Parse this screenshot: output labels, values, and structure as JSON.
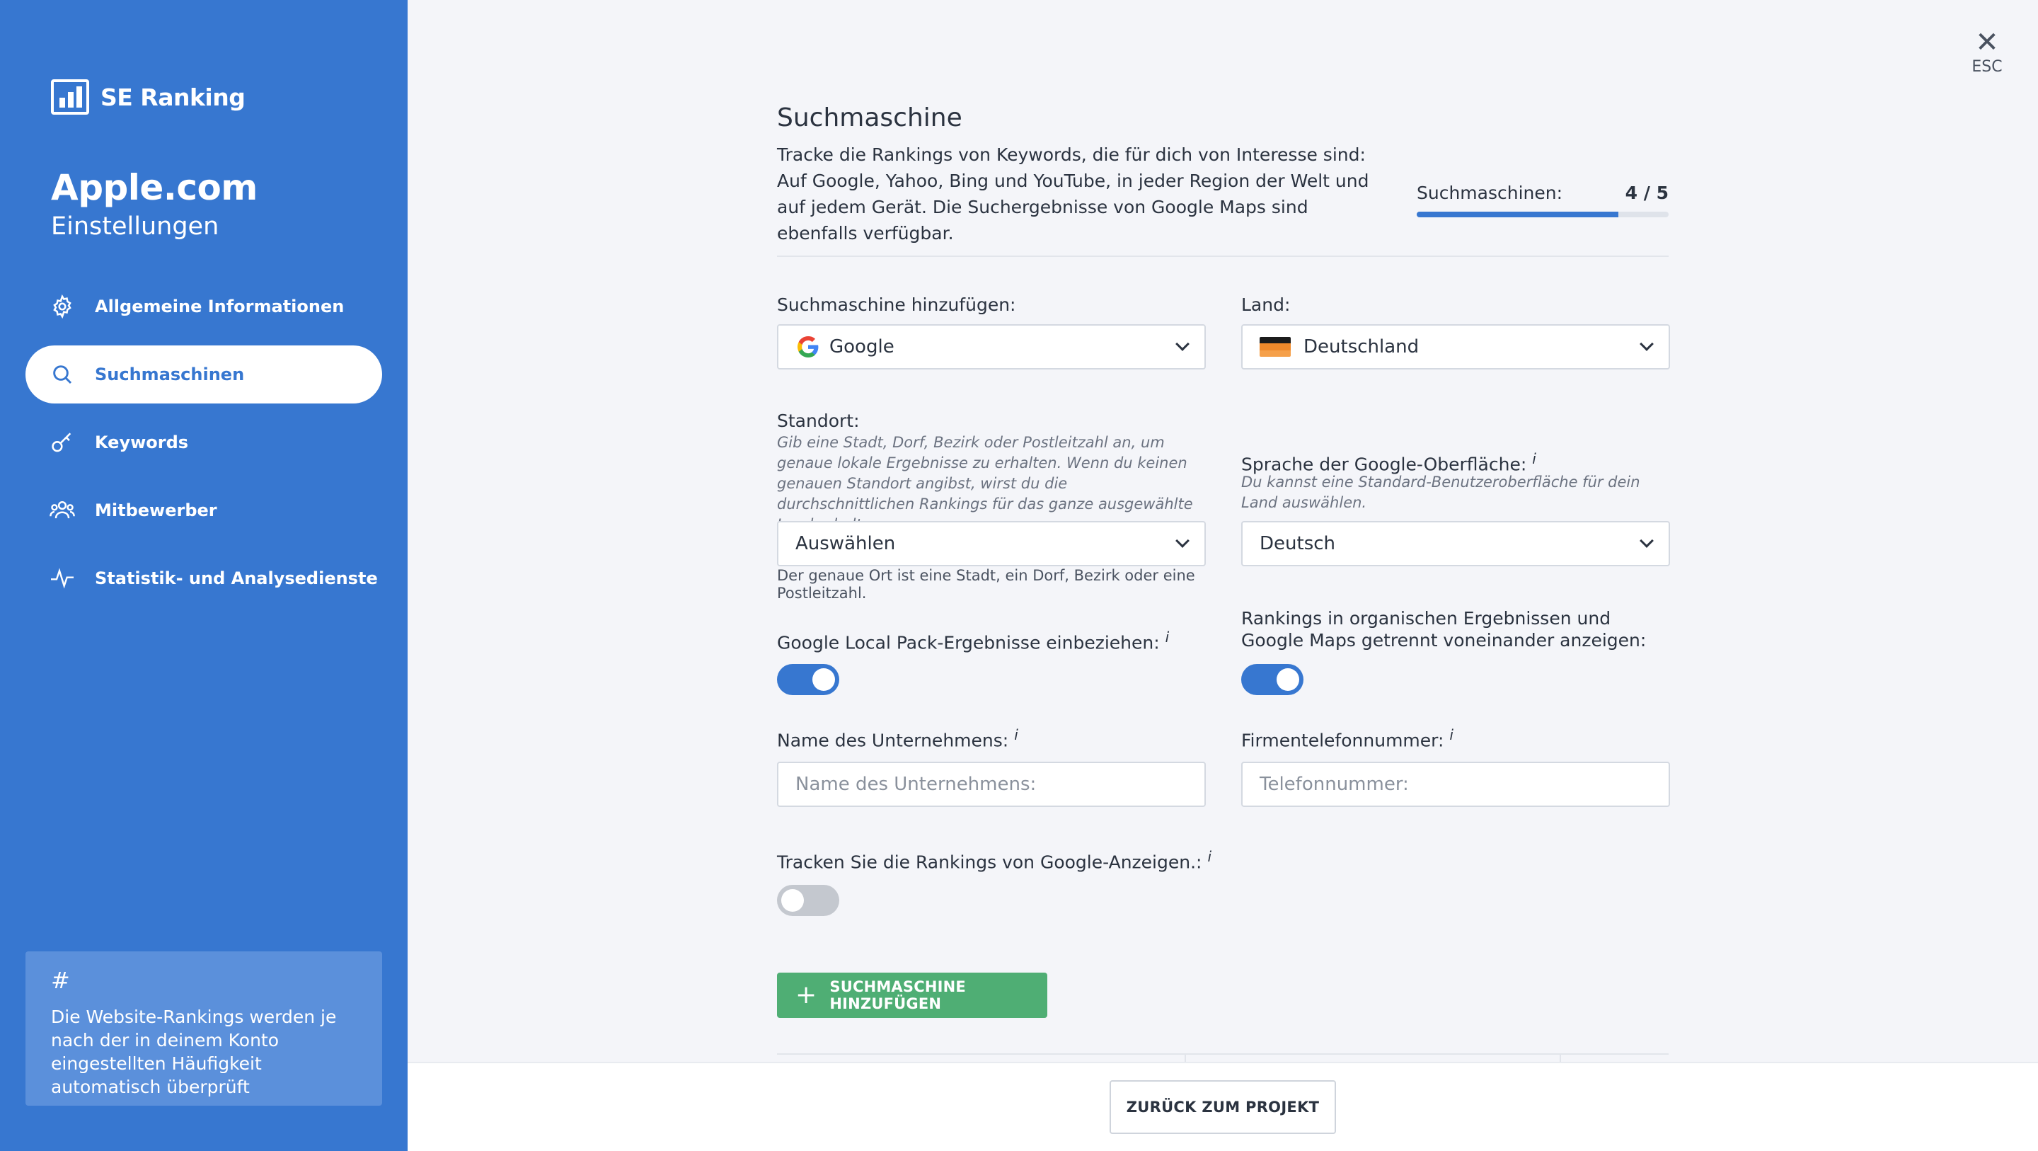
{
  "app": {
    "logo_text": "SE Ranking",
    "project_title": "Apple.com",
    "project_subtitle": "Einstellungen"
  },
  "sidebar": {
    "items": [
      {
        "label": "Allgemeine Informationen",
        "icon": "gear-icon"
      },
      {
        "label": "Suchmaschinen",
        "icon": "search-icon",
        "active": true
      },
      {
        "label": "Keywords",
        "icon": "key-icon"
      },
      {
        "label": "Mitbewerber",
        "icon": "users-icon"
      },
      {
        "label": "Statistik- und Analysedienste",
        "icon": "pulse-icon"
      }
    ],
    "info_symbol": "#",
    "info_text": "Die Website-Rankings werden je nach der in deinem Konto eingestellten Häufigkeit automatisch überprüft"
  },
  "close": {
    "label": "ESC",
    "symbol": "✕"
  },
  "main": {
    "title": "Suchmaschine",
    "intro": "Tracke die Rankings von Keywords, die für dich von Interesse sind: Auf Google, Yahoo, Bing und YouTube, in jeder Region der Welt und auf jedem Gerät. Die Suchergebnisse von Google Maps sind ebenfalls verfügbar.",
    "counter_label": "Suchmaschinen:",
    "counter_value": "4 / 5",
    "counter_fraction": 0.8,
    "engine_label": "Suchmaschine hinzufügen:",
    "engine_value": "Google",
    "country_label": "Land:",
    "country_value": "Deutschland",
    "location_label": "Standort:",
    "location_hint": "Gib eine Stadt, Dorf, Bezirk oder Postleitzahl an, um genaue lokale Ergebnisse zu erhalten. Wenn du keinen genauen Standort angibst, wirst du die durchschnittlichen Rankings für das ganze ausgewählte Land erhalten.",
    "location_value": "Auswählen",
    "location_helper": "Der genaue Ort ist eine Stadt, ein Dorf, Bezirk oder eine Postleitzahl.",
    "language_label": "Sprache der Google-Oberfläche:",
    "language_hint": "Du kannst eine Standard-Benutzeroberfläche für dein Land auswählen.",
    "language_value": "Deutsch",
    "local_pack_label": "Google Local Pack-Ergebnisse einbeziehen:",
    "local_pack_on": true,
    "maps_separate_label": "Rankings in organischen Ergebnissen und Google Maps getrennt voneinander anzeigen:",
    "maps_separate_on": true,
    "company_name_label": "Name des Unternehmens:",
    "company_name_placeholder": "Name des Unternehmens:",
    "company_phone_label": "Firmentelefonnummer:",
    "company_phone_placeholder": "Telefonnummer:",
    "ads_label": "Tracken Sie die Rankings von Google-Anzeigen.:",
    "ads_on": false,
    "info_marker": "i",
    "add_button": "SUCHMASCHINE HINZUFÜGEN",
    "add_symbol": "+"
  },
  "footer": {
    "back_button": "ZURÜCK ZUM PROJEKT"
  },
  "colors": {
    "sidebar": "#3777d0",
    "accent": "#3777d0",
    "success": "#4fae74",
    "background": "#f4f5f9"
  }
}
